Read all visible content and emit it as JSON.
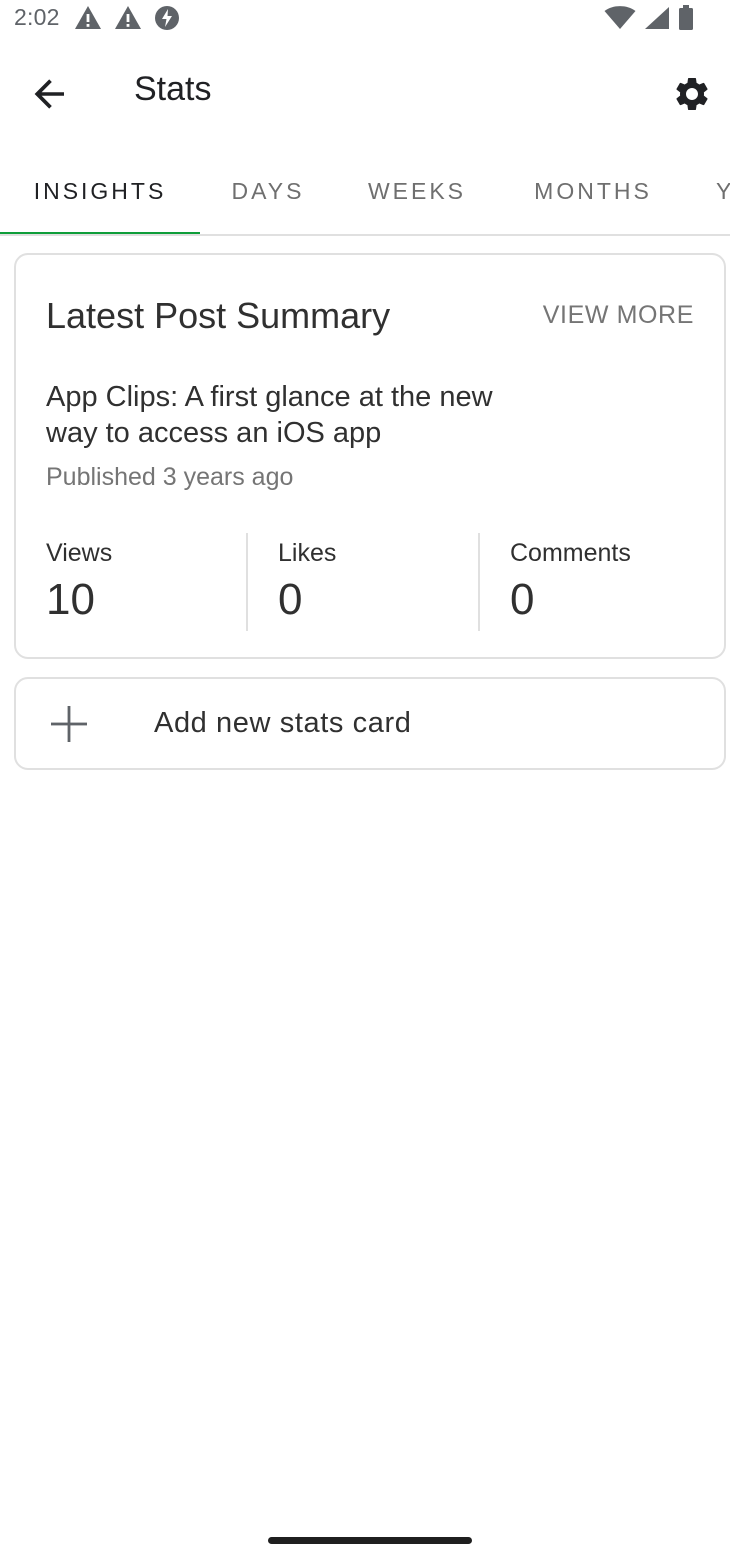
{
  "status_bar": {
    "time": "2:02",
    "left_icons": [
      "warning-icon",
      "warning-icon",
      "data-saver-icon"
    ],
    "right_icons": [
      "wifi-icon",
      "cell-signal-icon",
      "battery-icon"
    ]
  },
  "app_bar": {
    "title": "Stats",
    "back_icon": "arrow-back-icon",
    "settings_icon": "gear-icon"
  },
  "tabs": [
    {
      "label": "INSIGHTS",
      "active": true
    },
    {
      "label": "DAYS",
      "active": false
    },
    {
      "label": "WEEKS",
      "active": false
    },
    {
      "label": "MONTHS",
      "active": false
    },
    {
      "label": "Y",
      "active": false
    }
  ],
  "summary_card": {
    "title": "Latest Post Summary",
    "view_more": "VIEW MORE",
    "post_title": "App Clips: A first glance at the new way to access an iOS app",
    "published": "Published 3 years ago",
    "stats": [
      {
        "label": "Views",
        "value": "10"
      },
      {
        "label": "Likes",
        "value": "0"
      },
      {
        "label": "Comments",
        "value": "0"
      }
    ]
  },
  "add_card": {
    "label": "Add new stats card",
    "icon": "plus-icon"
  },
  "colors": {
    "accent": "#0e9e3a",
    "text_primary": "#202124",
    "text_secondary": "#757575",
    "divider": "#e0e0e0"
  }
}
